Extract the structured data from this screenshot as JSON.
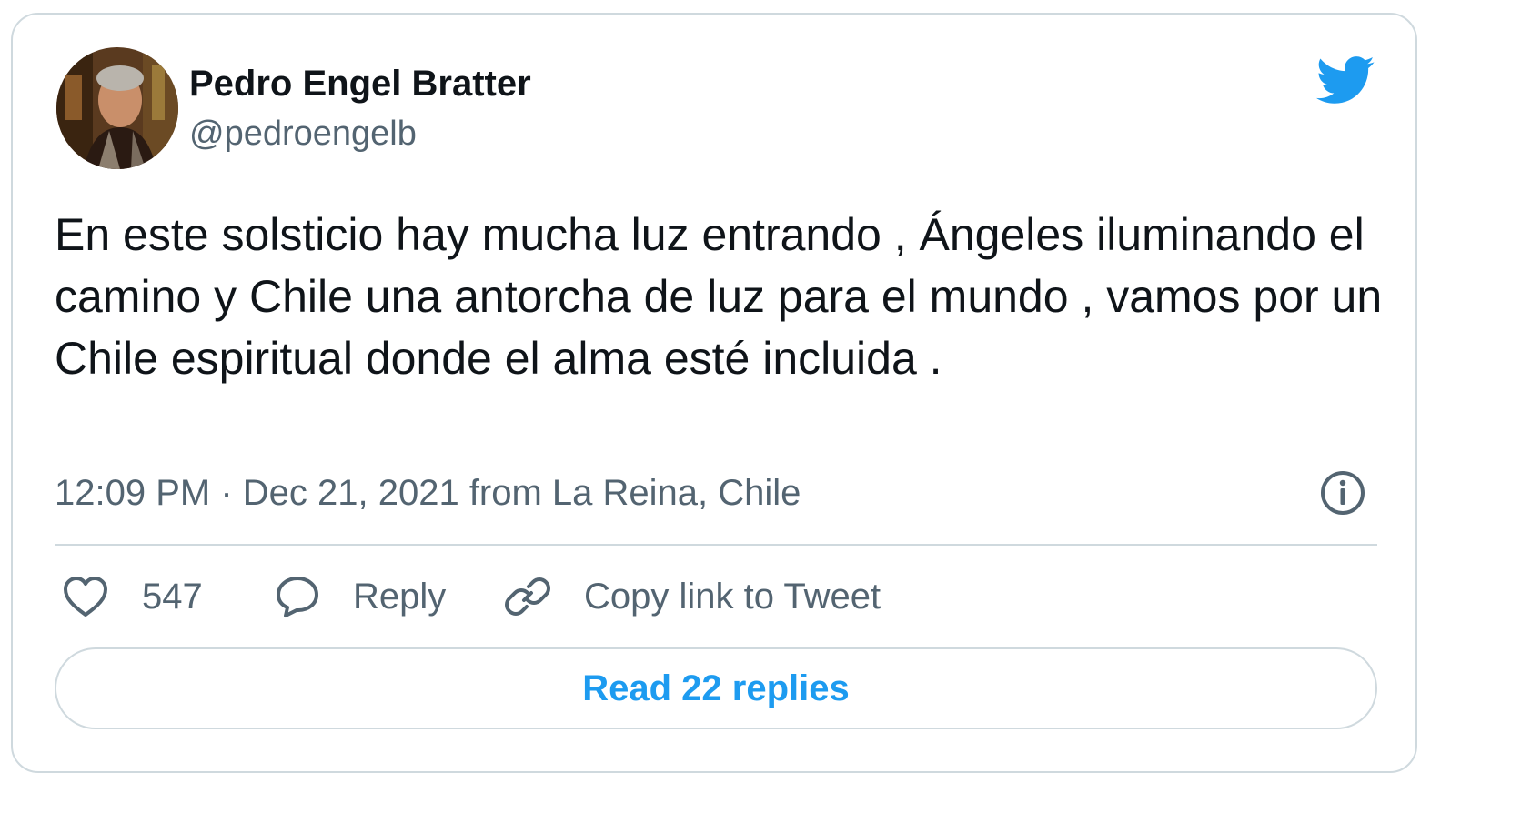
{
  "author": {
    "name": "Pedro Engel Bratter",
    "handle": "@pedroengelb"
  },
  "tweet": {
    "text": "En este solsticio hay mucha luz entrando , Ángeles iluminando el camino y Chile una antorcha de luz para el mundo , vamos por un Chile espiritual donde el alma esté incluida .",
    "meta": "12:09 PM · Dec 21, 2021 from La Reina, Chile"
  },
  "actions": {
    "likes_count": "547",
    "reply_label": "Reply",
    "copy_link_label": "Copy link to Tweet"
  },
  "read_replies_label": "Read 22 replies",
  "icons": {
    "brand": "twitter-bird-icon",
    "info": "info-icon",
    "like": "heart-icon",
    "reply": "speech-bubble-icon",
    "copy": "link-icon"
  },
  "colors": {
    "accent": "#1d9bf0",
    "text": "#0f1419",
    "secondary": "#536471",
    "border": "#cfd9de"
  }
}
